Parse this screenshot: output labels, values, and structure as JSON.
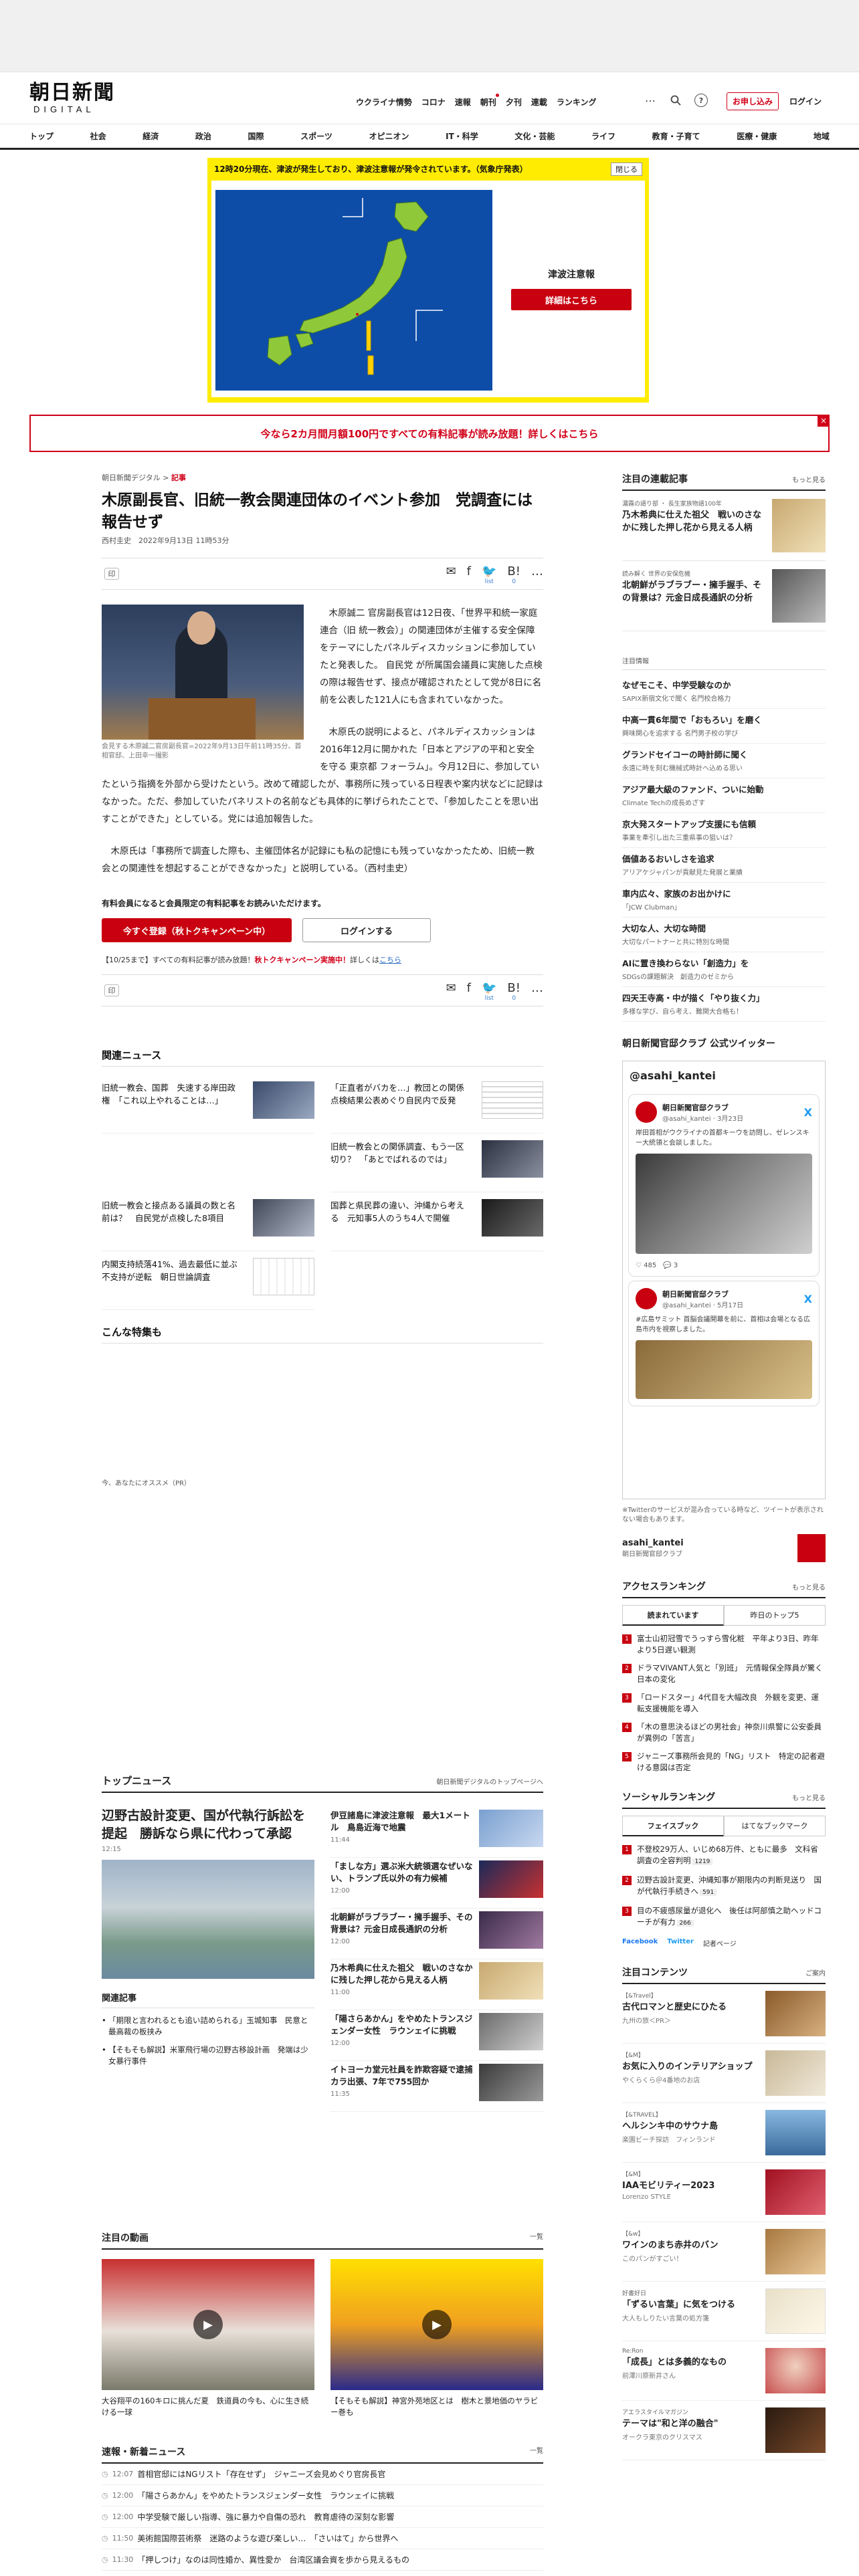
{
  "header": {
    "logo_jp": "朝日新聞",
    "logo_en": "DIGITAL",
    "nav": [
      "ウクライナ情勢",
      "コロナ",
      "速報",
      "朝刊",
      "夕刊",
      "連載",
      "ランキング"
    ],
    "apply_label": "お申し込み",
    "login_label": "ログイン"
  },
  "categories": [
    "トップ",
    "社会",
    "経済",
    "政治",
    "国際",
    "スポーツ",
    "オピニオン",
    "IT・科学",
    "文化・芸能",
    "ライフ",
    "教育・子育て",
    "医療・健康",
    "地域"
  ],
  "alert": {
    "headline": "12時20分現在、津波が発生しており、津波注意報が発令されています。（気象庁発表）",
    "close_label": "閉じる",
    "title": "津波注意報",
    "button": "詳細はこちら"
  },
  "campaign": {
    "text": "今なら2カ月間月額100円ですべての有料記事が読み放題！詳しくはこちら",
    "close": "×"
  },
  "article": {
    "breadcrumb_site": "朝日新聞デジタル",
    "breadcrumb_sep": ">",
    "breadcrumb_current": "記事",
    "title": "木原副長官、旧統一教会関連団体のイベント参加　党調査には報告せず",
    "byline": "西村圭史　2022年9月13日 11時53分",
    "print_label": "印",
    "share": {
      "mail": "✉",
      "facebook": "f",
      "twitter": "🐦",
      "hatena": "B!",
      "more": "…",
      "list_label": "list",
      "count": "0"
    },
    "photo_caption": "会見する木原誠二官房副長官=2022年9月13日午前11時35分、首相官邸、上田幸一撮影",
    "paragraphs": [
      "木原誠二 官房副長官は12日夜、「世界平和統一家庭連合（旧 統一教会）」の関連団体が主催する安全保障をテーマにしたパネルディスカッションに参加していたと発表した。 自民党 が所属国会議員に実施した点検の際は報告せず、接点が確認されたとして党が8日に名前を公表した121人にも含まれていなかった。",
      "木原氏の説明によると、パネルディスカッションは2016年12月に開かれた「日本とアジアの平和と安全を守る 東京都 フォーラム」。今月12日に、参加していたという指摘を外部から受けたという。改めて確認したが、事務所に残っている日程表や案内状などに記録はなかった。ただ、参加していたパネリストの名前なども具体的に挙げられたことで、「参加したことを思い出すことができた」としている。党には追加報告した。",
      "木原氏は「事務所で調査した際も、主催団体名が記録にも私の記憶にも残っていなかったため、旧統一教会との関連性を想起することができなかった」と説明している。（西村圭史）"
    ],
    "member_note": "有料会員になると会員限定の有料記事をお読みいただけます。",
    "register_btn": "今すぐ登録（秋トクキャンペーン中）",
    "login_btn": "ログインする",
    "promo_prefix": "【10/25まで】すべての有料記事が読み放題！",
    "promo_red": "秋トクキャンペーン実施中！",
    "promo_suffix": "詳しくは",
    "promo_link": "こちら"
  },
  "related": {
    "heading": "関連ニュース",
    "items": [
      {
        "title": "旧統一教会、国葬　失速する岸田政権　「これ以上やれることは…」"
      },
      {
        "title": "「正直者がバカを…」教団との関係　点検結果公表めぐり自民内で反発"
      },
      {
        "title": ""
      },
      {
        "title": "旧統一教会との関係調査、もう一区切り？　「あとでばれるのでは」"
      },
      {
        "title": "旧統一教会と接点ある議員の数と名前は？　自民党が点検した8項目"
      },
      {
        "title": "国葬と県民葬の違い、沖縄から考える　元知事5人のうち4人で開催"
      },
      {
        "title": "内閣支持続落41%、過去最低に並ぶ　不支持が逆転　朝日世論調査"
      },
      {
        "title": ""
      }
    ],
    "special_heading": "こんな特集も",
    "recommend_label": "今、あなたにオススメ（PR）"
  },
  "sidebar": {
    "series_heading": "注目の連載記事",
    "more": "もっと見る",
    "series": [
      {
        "cat": "濃霧の語り部 ・ 長生家族物語100年",
        "title": "乃木希典に仕えた祖父　戦いのさなかに残した押し花から見える人柄"
      },
      {
        "cat": "読み解く 世界の安保危機",
        "title": "北朝鮮がラブラブー・擁手握手、その背景は？元金日成長通訳の分析"
      }
    ],
    "ad_label": "注目情報",
    "ads": [
      {
        "title": "なぜモこそ、中学受験なのか",
        "sub": "SAPIX新宿文化で聞く 名門校合格力"
      },
      {
        "title": "中高一貫6年間で「おもろい」を磨く",
        "sub": "興味関心を追求する 名門男子校の学び"
      },
      {
        "title": "グランドセイコーの時計師に聞く",
        "sub": "永遠に時を刻む機械式時計へ込める思い"
      },
      {
        "title": "アジア最大級のファンド、ついに始動",
        "sub": "Climate Techの成長めざす"
      },
      {
        "title": "京大発スタートアップ支援にも信頼",
        "sub": "事業を牽引し出た三重県事の狙いは？"
      },
      {
        "title": "価値あるおいしさを追求",
        "sub": "アリアケジャパンが貢献見た発展と業績"
      },
      {
        "title": "車内広々、家族のお出かけに",
        "sub": "「JCW Clubman」"
      },
      {
        "title": "大切な人、大切な時間",
        "sub": "大切なパートナーと共に特別な時間"
      },
      {
        "title": "AIに置き換わらない「創造力」を",
        "sub": "SDGsの課題解決　創造力のゼミから"
      },
      {
        "title": "四天王寺高・中が描く「やり抜く力」",
        "sub": "多様な学び、自ら考え、難関大合格も！"
      }
    ],
    "twitter_heading": "朝日新聞官邸クラブ 公式ツイッター",
    "twitter_handle": "@asahi_kantei",
    "tweets": [
      {
        "name": "朝日新聞官邸クラブ",
        "id": "@asahi_kantei · 3月23日",
        "text": "岸田首相がウクライナの首都キーウを訪問し、ゼレンスキー大統領と会談しました。",
        "likes": "485",
        "replies": "3"
      },
      {
        "name": "朝日新聞官邸クラブ",
        "id": "@asahi_kantei · 5月17日",
        "text": "#広島サミット 首脳会議開幕を前に、首相は会場となる広島市内を視察しました。"
      }
    ],
    "twitter_note": "※Twitterのサービスが混み合っている時など、ツイートが表示されない場合もあります。",
    "account_name": "asahi_kantei",
    "account_sub": "朝日新聞官邸クラブ",
    "ranking_heading": "アクセスランキング",
    "ranking_tabs": [
      "読まれています",
      "昨日のトップ5"
    ],
    "ranking": [
      {
        "n": "1",
        "t": "富士山初冠雪でうっすら雪化粧　平年より3日、昨年より5日遅い観測"
      },
      {
        "n": "2",
        "t": "ドラマVIVANT人気と「別班」　元情報保全隊員が驚く日本の変化"
      },
      {
        "n": "3",
        "t": "「ロードスター」4代目を大幅改良　外観を変更、運転支援機能を導入"
      },
      {
        "n": "4",
        "t": "「木の意思決るほどの男社会」神奈川県警に公安委員が異例の「苦言」"
      },
      {
        "n": "5",
        "t": "ジャニーズ事務所会見的「NG」リスト　特定の記者避ける意図は否定"
      }
    ],
    "social_heading": "ソーシャルランキング",
    "social_tabs": [
      "フェイスブック",
      "はてなブックマーク"
    ],
    "social": [
      {
        "n": "1",
        "t": "不登校29万人、いじめ68万件、ともに最多　文科省調査の全容判明",
        "b": "1219"
      },
      {
        "n": "2",
        "t": "辺野古設計変更、沖縄知事が期限内の判断見送り　国が代執行手続きへ",
        "b": "591"
      },
      {
        "n": "3",
        "t": "目の不疲感尿量が退化へ　後任は阿部慎之助ヘッドコーチが有力",
        "b": "266"
      }
    ],
    "social_share": [
      "Facebook",
      "Twitter",
      "記者ページ"
    ],
    "content_heading": "注目コンテンツ",
    "content_more": "ご案内",
    "contents": [
      {
        "cat": "【&Travel】",
        "title": "古代ロマンと歴史にひたる",
        "sub": "九州の旅＜PR＞"
      },
      {
        "cat": "【&M】",
        "title": "お気に入りのインテリアショップ",
        "sub": "やくらくら＠4番地のお店"
      },
      {
        "cat": "【&TRAVEL】",
        "title": "ヘルシンキ中のサウナ島",
        "sub": "楽園ビーチ探訪　フィンランド"
      },
      {
        "cat": "【&M】",
        "title": "IAAモビリティー2023",
        "sub": "Lorenzo STYLE"
      },
      {
        "cat": "【&w】",
        "title": "ワインのまち赤井のバン",
        "sub": "このパンがすごい！"
      },
      {
        "cat": "好書好日",
        "title": "「ずるい言葉」に気をつける",
        "sub": "大人もしりたい言葉の処方箋"
      },
      {
        "cat": "Re:Ron",
        "title": "「成長」とは多義的なもの",
        "sub": "前澤川原新井さん"
      },
      {
        "cat": "アエラスタイルマガジン",
        "title": "テーマは\"和と洋の融合\"",
        "sub": "オークラ東京のクリスマス"
      }
    ]
  },
  "topnews": {
    "heading": "トップニュース",
    "more": "朝日新聞デジタルのトップページへ",
    "lead_title": "辺野古設計変更、国が代執行訴訟を提起　勝訴なら県に代わって承認",
    "lead_time": "12:15",
    "rel_heading": "関連記事",
    "rel": [
      "「期限と言われるとも追い詰められる」玉城知事　民意と最高裁の板挟み",
      "【そもそも解説】米軍飛行場の辺野古移設計画　発端は少女暴行事件"
    ],
    "items": [
      {
        "title": "伊豆諸島に津波注意報　最大1メートル　鳥島近海で地震",
        "time": "11:44"
      },
      {
        "title": "「ましな方」選ぶ米大統領選なぜいない、トランプ氏以外の有力候補",
        "time": "12:00"
      },
      {
        "title": "北朝鮮がラブラブー・擁手握手、その背景は？元金日成長通訳の分析",
        "time": "12:00"
      },
      {
        "title": "乃木希典に仕えた祖父　戦いのさなかに残した押し花から見える人柄",
        "time": "11:00"
      },
      {
        "title": "「陽さらあかん」をやめたトランスジェンダー女性　ラウンェイに挑戦",
        "time": "12:00"
      },
      {
        "title": "イトヨーカ堂元社員を詐欺容疑で逮捕　カラ出張、7年で755回か",
        "time": "11:35"
      }
    ]
  },
  "videos": {
    "heading": "注目の動画",
    "more": "一覧",
    "items": [
      {
        "title": "大谷翔平の160キロに挑んだ夏　鉄道員の今も、心に生き続ける一球"
      },
      {
        "title": "【そもそも解説】神宮外苑地区とは　樹木と景地価のヤラビー巻も"
      }
    ]
  },
  "latest": {
    "heading": "速報・新着ニュース",
    "more": "一覧",
    "items": [
      {
        "time": "12:07",
        "title": "首相官邸にはNGリスト「存在せず」　ジャニーズ会見めぐり官房長官"
      },
      {
        "time": "12:00",
        "title": "「陽さらあかん」をやめたトランスジェンダー女性　ラウンェイに挑戦"
      },
      {
        "time": "12:00",
        "title": "中学受験で厳しい指導、強に暴力や自傷の恐れ　教育虐待の深刻な影響"
      },
      {
        "time": "11:50",
        "title": "美術館国際芸術祭　迷路のような遊び楽しい…　「さいはて」から世界へ"
      },
      {
        "time": "11:30",
        "title": "「押しつけ」なのは同性婚か、異性愛か　台湾区議会資を歩から見えるもの"
      }
    ]
  },
  "colors": {
    "brand_red": "#d10019",
    "alert_yellow": "#ffec00",
    "map_blue": "#0d4da8"
  }
}
